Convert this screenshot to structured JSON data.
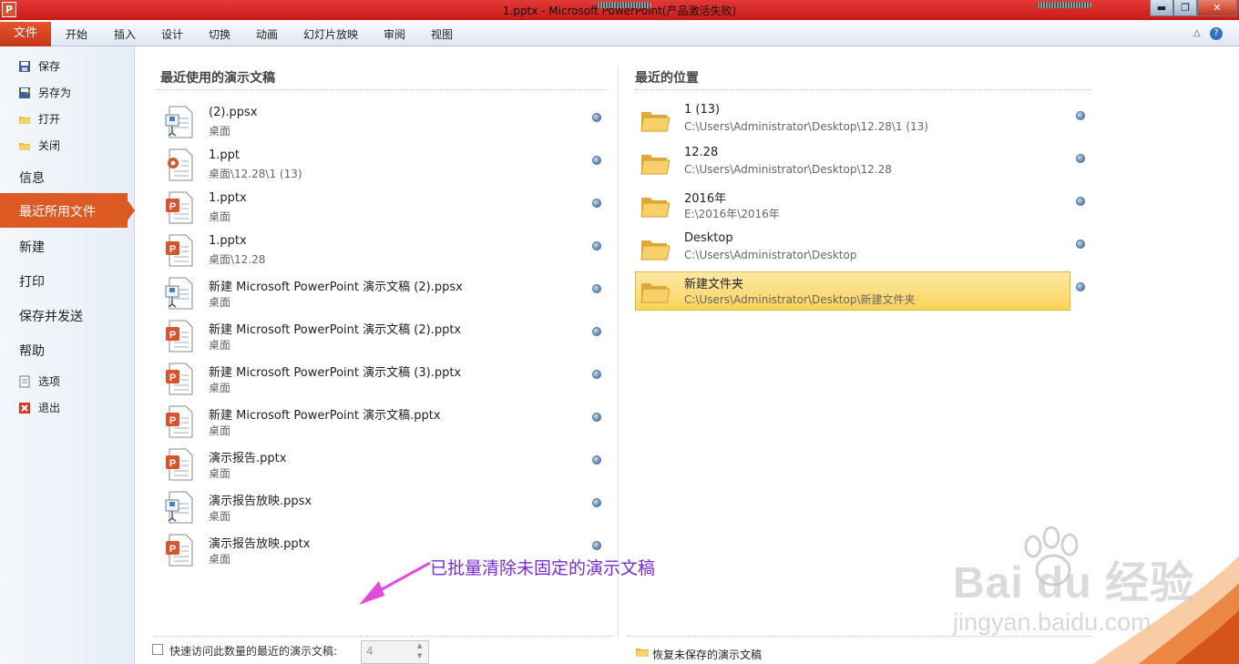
{
  "window": {
    "title": "1.pptx  -  Microsoft PowerPoint(产品激活失败)",
    "app_icon": "P",
    "minimize_glyph": "▬",
    "maximize_glyph": "❐",
    "close_glyph": "✕"
  },
  "ribbon": {
    "file_tab": "文件",
    "tabs": [
      "开始",
      "插入",
      "设计",
      "切换",
      "动画",
      "幻灯片放映",
      "审阅",
      "视图"
    ],
    "help_glyph": "?",
    "minimize_glyph": "△"
  },
  "sidebar": {
    "commands": [
      "保存",
      "另存为",
      "打开",
      "关闭"
    ],
    "info": "信息",
    "recent": "最近所用文件",
    "new": "新建",
    "print": "打印",
    "save_send": "保存并发送",
    "help": "帮助",
    "options": "选项",
    "exit": "退出"
  },
  "recent_files": {
    "heading": "最近使用的演示文稿",
    "items": [
      {
        "name": "(2).ppsx",
        "path": "桌面",
        "icon": "ppsx-icon"
      },
      {
        "name": "1.ppt",
        "path": "桌面\\12.28\\1 (13)",
        "icon": "ppt-icon"
      },
      {
        "name": "1.pptx",
        "path": "桌面",
        "icon": "pptx-icon"
      },
      {
        "name": "1.pptx",
        "path": "桌面\\12.28",
        "icon": "pptx-icon"
      },
      {
        "name": "新建 Microsoft PowerPoint 演示文稿 (2).ppsx",
        "path": "桌面",
        "icon": "ppsx-icon"
      },
      {
        "name": "新建 Microsoft PowerPoint 演示文稿 (2).pptx",
        "path": "桌面",
        "icon": "pptx-icon"
      },
      {
        "name": "新建 Microsoft PowerPoint 演示文稿 (3).pptx",
        "path": "桌面",
        "icon": "pptx-icon"
      },
      {
        "name": "新建 Microsoft PowerPoint 演示文稿.pptx",
        "path": "桌面",
        "icon": "pptx-icon"
      },
      {
        "name": "演示报告.pptx",
        "path": "桌面",
        "icon": "pptx-icon"
      },
      {
        "name": "演示报告放映.ppsx",
        "path": "桌面",
        "icon": "ppsx-icon"
      },
      {
        "name": "演示报告放映.pptx",
        "path": "桌面",
        "icon": "pptx-icon"
      }
    ]
  },
  "recent_places": {
    "heading": "最近的位置",
    "items": [
      {
        "name": "1 (13)",
        "path": "C:\\Users\\Administrator\\Desktop\\12.28\\1 (13)"
      },
      {
        "name": "12.28",
        "path": "C:\\Users\\Administrator\\Desktop\\12.28"
      },
      {
        "name": "2016年",
        "path": "E:\\2016年\\2016年"
      },
      {
        "name": "Desktop",
        "path": "C:\\Users\\Administrator\\Desktop"
      },
      {
        "name": "新建文件夹",
        "path": "C:\\Users\\Administrator\\Desktop\\新建文件夹",
        "selected": true
      }
    ]
  },
  "footer": {
    "quick_access_label": "快速访问此数量的最近的演示文稿:",
    "quick_access_value": "4",
    "quick_access_checked": false,
    "recover_label": "恢复未保存的演示文稿"
  },
  "annotation": "已批量清除未固定的演示文稿",
  "watermark": {
    "main": "Bai du 经验",
    "sub": "jingyan.baidu.com"
  },
  "colors": {
    "accent": "#dd5a24",
    "title_bar": "#d42a28",
    "annotation": "#7a2bd6",
    "selection": "#fbd35a"
  }
}
